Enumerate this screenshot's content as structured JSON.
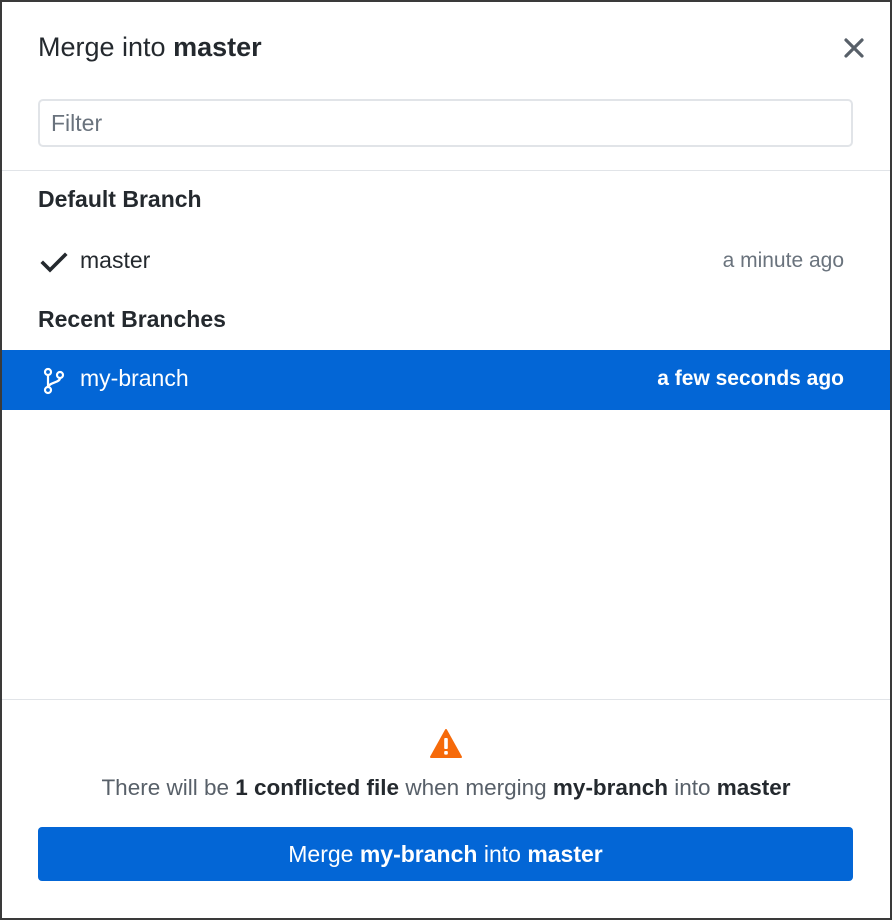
{
  "dialog": {
    "title_prefix": "Merge into",
    "title_branch": "master",
    "close_icon": "close-icon"
  },
  "filter": {
    "placeholder": "Filter",
    "value": ""
  },
  "sections": {
    "default": {
      "title": "Default Branch",
      "branches": [
        {
          "name": "master",
          "time": "a minute ago",
          "icon": "checkmark-icon",
          "selected": false
        }
      ]
    },
    "recent": {
      "title": "Recent Branches",
      "branches": [
        {
          "name": "my-branch",
          "time": "a few seconds ago",
          "icon": "git-branch-icon",
          "selected": true
        }
      ]
    }
  },
  "footer": {
    "warning_icon": "warning-icon",
    "message": {
      "part1": "There will be",
      "count": "1 conflicted file",
      "part2": "when merging",
      "branch": "my-branch",
      "part3": "into",
      "target": "master"
    },
    "button": {
      "prefix": "Merge",
      "branch": "my-branch",
      "middle": "into",
      "target": "master"
    }
  },
  "colors": {
    "accent": "#0366d6",
    "warning": "#f66a0a",
    "muted_text": "#6a737d",
    "border": "#e1e4e8"
  }
}
